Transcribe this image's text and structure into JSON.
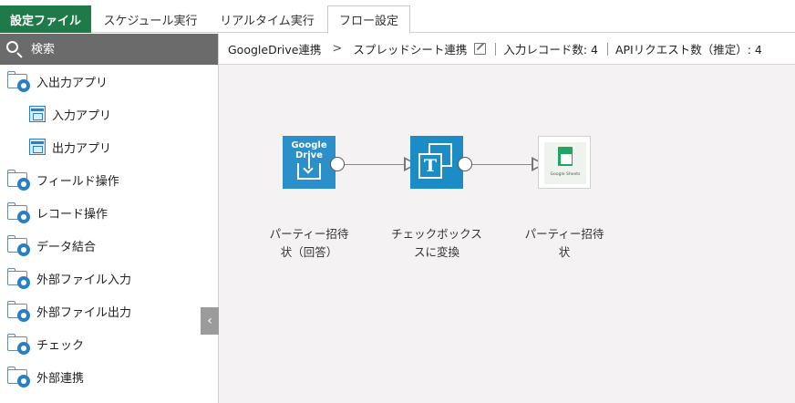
{
  "tabs": {
    "brand": "設定ファイル",
    "schedule": "スケジュール実行",
    "realtime": "リアルタイム実行",
    "flow": "フロー設定"
  },
  "sidebar": {
    "search_placeholder": "検索",
    "items": [
      {
        "label": "入出力アプリ",
        "icon": "folder-gear-icon"
      },
      {
        "label": "入力アプリ",
        "icon": "app-icon"
      },
      {
        "label": "出力アプリ",
        "icon": "app-icon"
      },
      {
        "label": "フィールド操作",
        "icon": "folder-gear-icon"
      },
      {
        "label": "レコード操作",
        "icon": "folder-gear-icon"
      },
      {
        "label": "データ結合",
        "icon": "folder-gear-icon"
      },
      {
        "label": "外部ファイル入力",
        "icon": "folder-gear-icon"
      },
      {
        "label": "外部ファイル出力",
        "icon": "folder-gear-icon"
      },
      {
        "label": "チェック",
        "icon": "folder-gear-icon"
      },
      {
        "label": "外部連携",
        "icon": "folder-gear-icon"
      }
    ],
    "collapse_glyph": "‹"
  },
  "breadcrumb": {
    "root": "GoogleDrive連携",
    "separator": ">",
    "current": "スプレッドシート連携",
    "input_records": "入力レコード数: 4",
    "api_requests": "APIリクエスト数（推定）: 4"
  },
  "flow": {
    "nodes": [
      {
        "id": "gdrive",
        "line1": "パーティー招待",
        "line2": "状（回答）",
        "icon_text": "Google Drive"
      },
      {
        "id": "checkbox",
        "line1": "チェックボックス",
        "line2": "スに変換",
        "icon_text": "T"
      },
      {
        "id": "gsheets",
        "line1": "パーティー招待",
        "line2": "状",
        "icon_text": "Google Sheets"
      }
    ]
  },
  "colors": {
    "brand_tab": "#1f7a4a",
    "node_blue": "#2b8fca",
    "sheets_green": "#22a463",
    "canvas_bg": "#f4f2f2"
  }
}
